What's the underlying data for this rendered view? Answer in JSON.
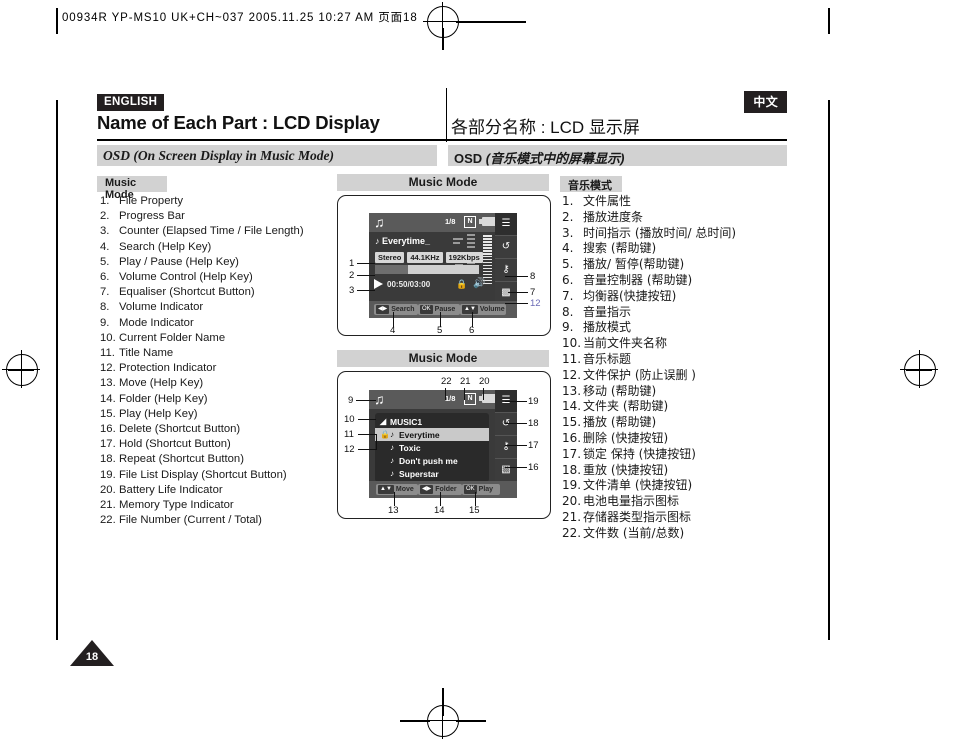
{
  "print_header": "00934R YP-MS10 UK+CH~037 2005.11.25 10:27 AM  页面18",
  "language_tags": {
    "english": "ENGLISH",
    "chinese": "中文"
  },
  "title": {
    "english": "Name of Each Part : LCD Display",
    "chinese": "各部分名称 : LCD 显示屏"
  },
  "section_band": {
    "english": "OSD (On Screen Display in Music Mode)",
    "chinese_prefix": "OSD ",
    "chinese_italic": "(音乐模式中的屏幕显示)"
  },
  "subheaders": {
    "english": "Music Mode",
    "chinese": "音乐模式",
    "figure_1": "Music Mode",
    "figure_2": "Music Mode"
  },
  "list_english": [
    {
      "num": "1.",
      "text": "File Property"
    },
    {
      "num": "2.",
      "text": "Progress Bar"
    },
    {
      "num": "3.",
      "text": "Counter (Elapsed Time / File Length)"
    },
    {
      "num": "4.",
      "text": "Search (Help Key)"
    },
    {
      "num": "5.",
      "text": "Play / Pause (Help Key)"
    },
    {
      "num": "6.",
      "text": "Volume Control (Help Key)"
    },
    {
      "num": "7.",
      "text": "Equaliser (Shortcut Button)"
    },
    {
      "num": "8.",
      "text": "Volume Indicator"
    },
    {
      "num": "9.",
      "text": "Mode Indicator"
    },
    {
      "num": "10.",
      "text": "Current Folder Name"
    },
    {
      "num": "11.",
      "text": "Title Name"
    },
    {
      "num": "12.",
      "text": "Protection Indicator"
    },
    {
      "num": "13.",
      "text": "Move (Help Key)"
    },
    {
      "num": "14.",
      "text": "Folder (Help Key)"
    },
    {
      "num": "15.",
      "text": "Play (Help Key)"
    },
    {
      "num": "16.",
      "text": "Delete (Shortcut Button)"
    },
    {
      "num": "17.",
      "text": "Hold (Shortcut Button)"
    },
    {
      "num": "18.",
      "text": "Repeat (Shortcut Button)"
    },
    {
      "num": "19.",
      "text": "File List Display (Shortcut Button)"
    },
    {
      "num": "20.",
      "text": "Battery Life Indicator"
    },
    {
      "num": "21.",
      "text": "Memory Type Indicator"
    },
    {
      "num": "22.",
      "text": "File Number (Current / Total)"
    }
  ],
  "list_chinese": [
    {
      "num": "1.",
      "text": "文件属性"
    },
    {
      "num": "2.",
      "text": "播放进度条"
    },
    {
      "num": "3.",
      "text": "时间指示 (播放时间/ 总时间)"
    },
    {
      "num": "4.",
      "text": "搜索 (帮助键)"
    },
    {
      "num": "5.",
      "text": "播放/ 暂停(帮助键)"
    },
    {
      "num": "6.",
      "text": "音量控制器 (帮助键)"
    },
    {
      "num": "7.",
      "text": "均衡器(快捷按钮)"
    },
    {
      "num": "8.",
      "text": "音量指示"
    },
    {
      "num": "9.",
      "text": "播放模式"
    },
    {
      "num": "10.",
      "text": "当前文件夹名称"
    },
    {
      "num": "11.",
      "text": "音乐标题"
    },
    {
      "num": "12.",
      "text": "文件保护 (防止误删 )"
    },
    {
      "num": "13.",
      "text": "移动 (帮助键)"
    },
    {
      "num": "14.",
      "text": "文件夹 (帮助键)"
    },
    {
      "num": "15.",
      "text": "播放 (帮助键)"
    },
    {
      "num": "16.",
      "text": "删除 (快捷按钮)"
    },
    {
      "num": "17.",
      "text": "锁定 保持 (快捷按钮)"
    },
    {
      "num": "18.",
      "text": "重放 (快捷按钮)"
    },
    {
      "num": "19.",
      "text": "文件清单 (快捷按钮)"
    },
    {
      "num": "20.",
      "text": "电池电量指示图标"
    },
    {
      "num": "21.",
      "text": "存储器类型指示图标"
    },
    {
      "num": "22.",
      "text": "文件数 (当前/总数)"
    }
  ],
  "lcd_playback": {
    "file_number": "1/8",
    "memory_type": "N",
    "track_title": "Everytime_",
    "chips": [
      "Stereo",
      "44.1KHz",
      "192Kbps"
    ],
    "counter": "00:50/03:00",
    "progress_percent": 32,
    "help_keys": [
      {
        "key": "◀▶",
        "label": "Search"
      },
      {
        "key": "OK",
        "label": "Pause"
      },
      {
        "key": "▲▼",
        "label": "Volume"
      }
    ],
    "side_icons": [
      "list-icon",
      "repeat-icon",
      "hold-icon",
      "equaliser-icon"
    ],
    "callouts_left": [
      "1",
      "2",
      "3"
    ],
    "callouts_right": [
      "8",
      "7",
      "12"
    ],
    "callouts_bottom": [
      "4",
      "5",
      "6"
    ]
  },
  "lcd_filelist": {
    "file_number": "1/8",
    "memory_type": "N",
    "folder": "MUSIC1",
    "files": [
      {
        "name": "Everytime",
        "selected": true,
        "locked": true
      },
      {
        "name": "Toxic",
        "selected": false,
        "locked": false
      },
      {
        "name": "Don't push me",
        "selected": false,
        "locked": false
      },
      {
        "name": "Superstar",
        "selected": false,
        "locked": false
      }
    ],
    "help_keys": [
      {
        "key": "▲▼",
        "label": "Move"
      },
      {
        "key": "◀▶",
        "label": "Folder"
      },
      {
        "key": "OK",
        "label": "Play"
      }
    ],
    "side_icons": [
      "list-icon",
      "repeat-icon",
      "hold-icon",
      "delete-icon"
    ],
    "callouts_left": [
      "9",
      "10",
      "11",
      "12"
    ],
    "callouts_right": [
      "19",
      "18",
      "17",
      "16"
    ],
    "callouts_top": [
      "22",
      "21",
      "20"
    ],
    "callouts_bottom": [
      "13",
      "14",
      "15"
    ]
  },
  "page_number": "18",
  "colors": {
    "tag_background": "#231f20",
    "band_background": "#d2d2d2",
    "lcd_background": "#3a3a3a",
    "callout_blue": "#6a6ab5"
  }
}
